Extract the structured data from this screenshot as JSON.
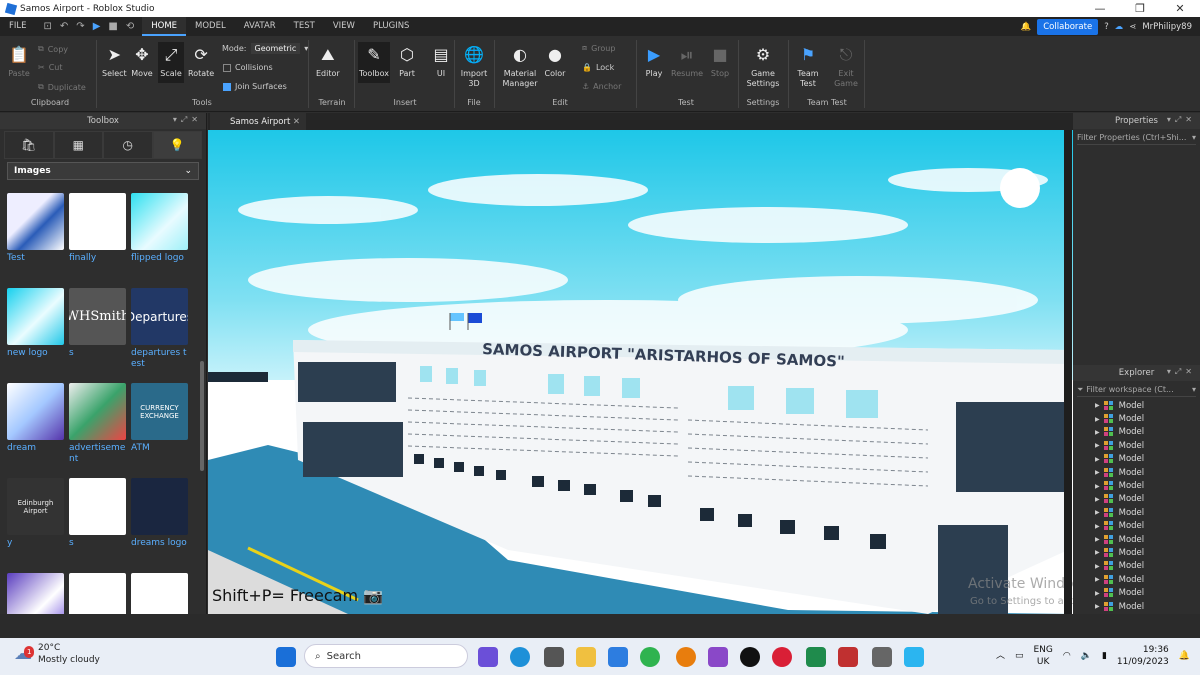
{
  "window": {
    "title": "Samos Airport - Roblox Studio",
    "controls": [
      "—",
      "❐",
      "✕"
    ]
  },
  "menu": {
    "file": "FILE",
    "tabs": [
      "HOME",
      "MODEL",
      "AVATAR",
      "TEST",
      "VIEW",
      "PLUGINS"
    ],
    "active_tab": "HOME",
    "collaborate": "Collaborate",
    "username": "MrPhilipy89"
  },
  "ribbon": {
    "clipboard": {
      "paste": "Paste",
      "copy": "Copy",
      "cut": "Cut",
      "duplicate": "Duplicate",
      "group": "Clipboard"
    },
    "tools": {
      "select": "Select",
      "move": "Move",
      "scale": "Scale",
      "rotate": "Rotate",
      "mode_label": "Mode:",
      "mode_value": "Geometric",
      "collisions": "Collisions",
      "join_surfaces": "Join Surfaces",
      "group": "Tools"
    },
    "terrain": {
      "editor": "Editor",
      "group": "Terrain"
    },
    "insert": {
      "toolbox": "Toolbox",
      "part": "Part",
      "ui": "UI",
      "group": "Insert"
    },
    "file": {
      "import": "Import 3D",
      "group": "File"
    },
    "edit": {
      "material": "Material Manager",
      "color": "Color",
      "group_btn": "Group",
      "lock": "Lock",
      "anchor": "Anchor",
      "group": "Edit"
    },
    "test": {
      "play": "Play",
      "resume": "Resume",
      "stop": "Stop",
      "group": "Test"
    },
    "settings": {
      "game_settings": "Game Settings",
      "group": "Settings"
    },
    "team_test": {
      "team_test": "Team Test",
      "exit_game": "Exit Game",
      "group": "Team Test"
    }
  },
  "toolbox": {
    "title": "Toolbox",
    "category": "Images",
    "items": [
      {
        "label": "Test"
      },
      {
        "label": "finally"
      },
      {
        "label": "flipped logo"
      },
      {
        "label": "new logo"
      },
      {
        "label": "s",
        "text": "WHSmith"
      },
      {
        "label": "departures test",
        "text": "Departures"
      },
      {
        "label": "dream"
      },
      {
        "label": "advertisement"
      },
      {
        "label": "ATM",
        "text": "CURRENCY EXCHANGE"
      },
      {
        "label": "y",
        "text": "Edinburgh Airport"
      },
      {
        "label": "s"
      },
      {
        "label": "dreams logo"
      },
      {
        "label": ""
      },
      {
        "label": ""
      },
      {
        "label": ""
      }
    ]
  },
  "viewport": {
    "tab": "Samos Airport",
    "sign": "SAMOS AIRPORT \"ARISTARHOS OF SAMOS\"",
    "overlay": "Shift+P= Freecam",
    "watermark_title": "Activate Windows",
    "watermark_sub": "Go to Settings to activate Windows."
  },
  "properties": {
    "title": "Properties",
    "filter": "Filter Properties (Ctrl+Shi..."
  },
  "explorer": {
    "title": "Explorer",
    "filter": "Filter workspace (Ct...",
    "items": [
      "Model",
      "Model",
      "Model",
      "Model",
      "Model",
      "Model",
      "Model",
      "Model",
      "Model",
      "Model",
      "Model",
      "Model",
      "Model",
      "Model",
      "Model",
      "Model"
    ]
  },
  "taskbar": {
    "temp": "20°C",
    "weather": "Mostly cloudy",
    "badge": "1",
    "search": "Search",
    "lang": "ENG",
    "region": "UK",
    "time": "19:36",
    "date": "11/09/2023"
  }
}
